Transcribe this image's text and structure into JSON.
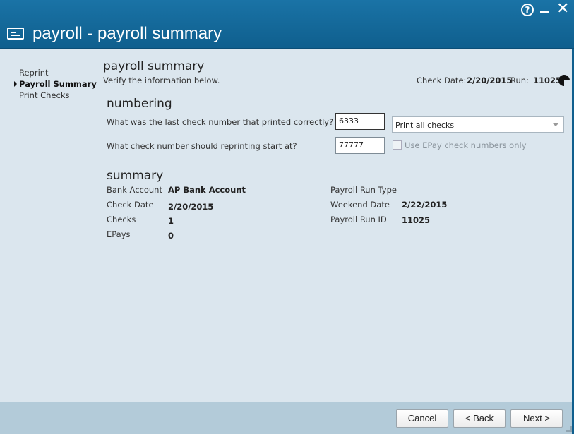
{
  "window": {
    "title": "payroll - payroll summary",
    "icons": [
      "card-icon",
      "help-icon",
      "minimize-icon",
      "close-icon"
    ],
    "accent": "#1a73a6"
  },
  "nav": {
    "items": [
      {
        "label": "Reprint"
      },
      {
        "label": "Payroll Summary",
        "active": true
      },
      {
        "label": "Print Checks"
      }
    ]
  },
  "page": {
    "heading": "payroll summary",
    "instruction": "Verify the information below.",
    "check_date_label": "Check Date:",
    "check_date_value": "2/20/2015",
    "run_label": "Run:",
    "run_value": "11025"
  },
  "numbering": {
    "heading": "numbering",
    "last_check_question": "What was the last check number that printed correctly?",
    "last_check_value": "6333",
    "reprint_start_question": "What check number should reprinting start at?",
    "reprint_start_value": "77777",
    "print_option_selected": "Print all checks",
    "epay_only_label": "Use EPay check numbers only",
    "epay_only_checked": false
  },
  "summary": {
    "heading": "summary",
    "left": [
      {
        "label": "Bank Account",
        "value": "AP Bank Account"
      },
      {
        "label": "Check Date",
        "value": "2/20/2015"
      },
      {
        "label": "Checks",
        "value": "1"
      },
      {
        "label": "EPays",
        "value": "0"
      }
    ],
    "right": [
      {
        "label": "Payroll Run Type",
        "value": ""
      },
      {
        "label": "Weekend Date",
        "value": "2/22/2015"
      },
      {
        "label": "Payroll Run ID",
        "value": "11025"
      }
    ]
  },
  "footer": {
    "cancel_label": "Cancel",
    "back_label": "< Back",
    "next_label": "Next >"
  }
}
